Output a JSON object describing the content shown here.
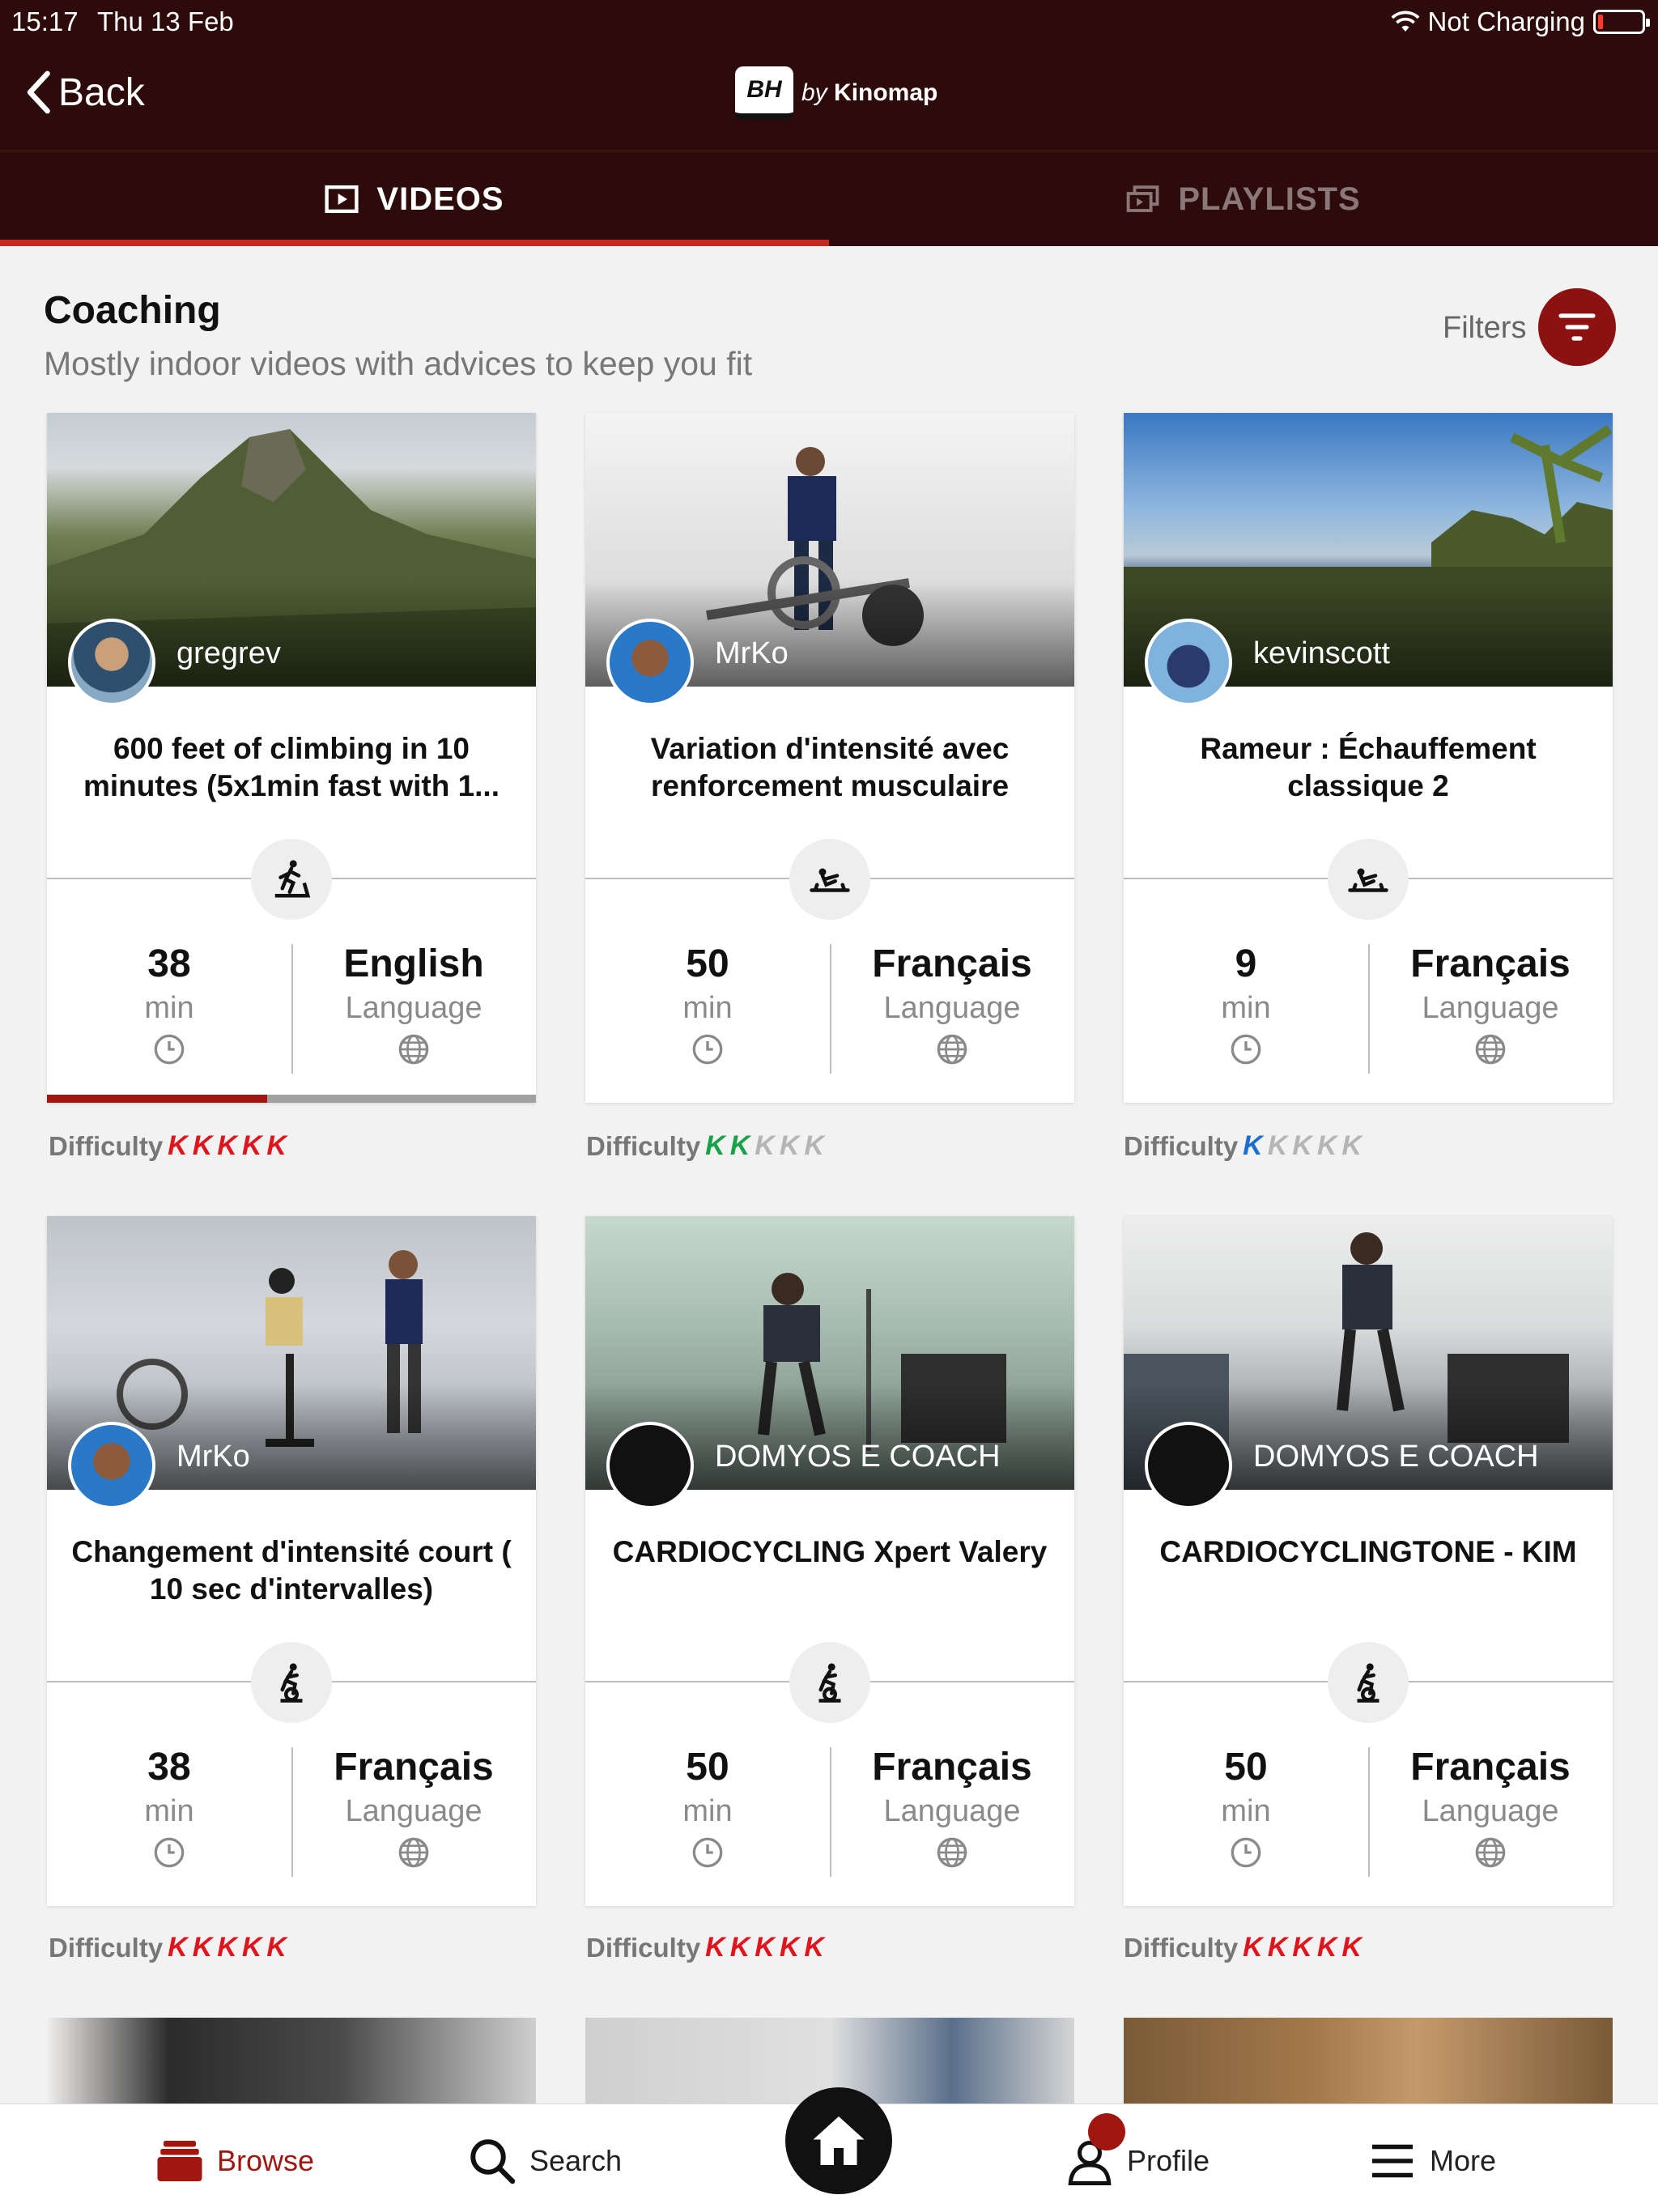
{
  "status_bar": {
    "time": "15:17",
    "date": "Thu 13 Feb",
    "battery_text": "Not Charging"
  },
  "nav": {
    "back_label": "Back",
    "logo_badge": "BH",
    "logo_by": "by",
    "logo_brand": "Kinomap"
  },
  "tabs": [
    {
      "label": "VIDEOS"
    },
    {
      "label": "PLAYLISTS"
    }
  ],
  "section": {
    "title": "Coaching",
    "subtitle": "Mostly indoor videos with advices to keep you fit",
    "filters_label": "Filters"
  },
  "cards": [
    {
      "author": "gregrev",
      "title": "600 feet of climbing in 10 minutes (5x1min fast with 1...",
      "duration": "38",
      "duration_unit": "min",
      "language": "English",
      "language_label": "Language",
      "difficulty_label": "Difficulty",
      "difficulty_level": 5,
      "difficulty_color": "#e0141c",
      "sport_icon": "treadmill-icon",
      "progress": 0.45
    },
    {
      "author": "MrKo",
      "title": "Variation d'intensité avec renforcement musculaire",
      "duration": "50",
      "duration_unit": "min",
      "language": "Français",
      "language_label": "Language",
      "difficulty_label": "Difficulty",
      "difficulty_level": 2,
      "difficulty_color": "#1aa24a",
      "sport_icon": "rower-icon"
    },
    {
      "author": "kevinscott",
      "title": "Rameur : Échauffement classique 2",
      "duration": "9",
      "duration_unit": "min",
      "language": "Français",
      "language_label": "Language",
      "difficulty_label": "Difficulty",
      "difficulty_level": 1,
      "difficulty_color": "#1a6fd0",
      "sport_icon": "rower-icon"
    },
    {
      "author": "MrKo",
      "title": "Changement d'intensité court ( 10 sec d'intervalles)",
      "duration": "38",
      "duration_unit": "min",
      "language": "Français",
      "language_label": "Language",
      "difficulty_label": "Difficulty",
      "difficulty_level": 5,
      "difficulty_color": "#e0141c",
      "sport_icon": "bike-icon"
    },
    {
      "author": "DOMYOS E COACH",
      "title": "CARDIOCYCLING Xpert Valery",
      "duration": "50",
      "duration_unit": "min",
      "language": "Français",
      "language_label": "Language",
      "difficulty_label": "Difficulty",
      "difficulty_level": 5,
      "difficulty_color": "#e0141c",
      "sport_icon": "bike-icon"
    },
    {
      "author": "DOMYOS E COACH",
      "title": "CARDIOCYCLINGTONE - KIM",
      "duration": "50",
      "duration_unit": "min",
      "language": "Français",
      "language_label": "Language",
      "difficulty_label": "Difficulty",
      "difficulty_level": 5,
      "difficulty_color": "#e0141c",
      "sport_icon": "bike-icon"
    }
  ],
  "bottom_nav": [
    {
      "label": "Browse"
    },
    {
      "label": "Search"
    },
    {
      "label": "Profile"
    },
    {
      "label": "More"
    }
  ],
  "colors": {
    "header_bg": "#2d0b0b",
    "accent": "#a1160f",
    "tab_indicator": "#c52a1e"
  }
}
